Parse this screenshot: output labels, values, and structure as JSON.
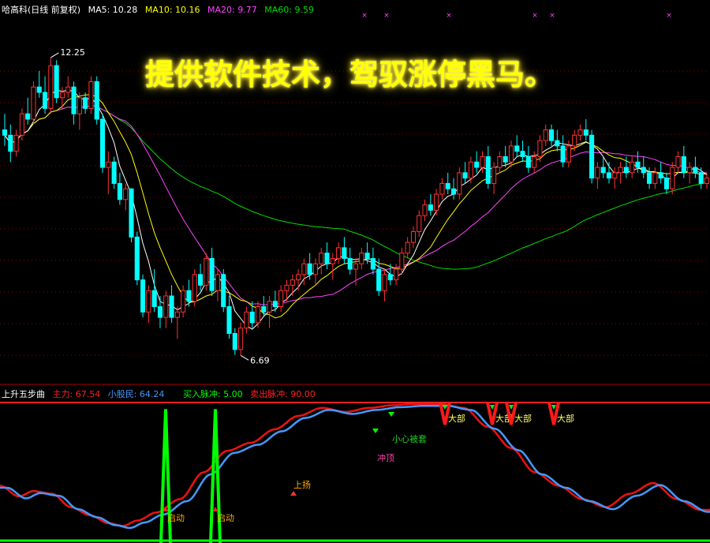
{
  "main_header": {
    "title": "哈高科(日线 前复权)",
    "ma5": "MA5: 10.28",
    "ma10": "MA10: 10.16",
    "ma20": "MA20: 9.77",
    "ma60": "MA60: 9.59"
  },
  "banner": "提供软件技术，驾驭涨停黑马。",
  "sub_header": {
    "title": "上升五步曲",
    "zhuli": "主力: 67.54",
    "xiaogumin": "小股民: 64.24",
    "buy_pulse": "买入脉冲: 5.00",
    "sell_pulse": "卖出脉冲: 90.00"
  },
  "colors": {
    "up": "#ff3333",
    "down": "#00ffff",
    "ma5": "#ffffff",
    "ma10": "#ffff00",
    "ma20": "#ff44ff",
    "ma60": "#00dd00",
    "zhuli": "#ee1111",
    "xiaogumin": "#4499ff",
    "pulse": "#00ff00",
    "grid": "#8b0000"
  },
  "chart_data": [
    {
      "type": "candlestick",
      "title": "哈高科(日线 前复权)",
      "ylim": [
        6.4,
        13.0
      ],
      "annotations": {
        "high": "12.25",
        "low": "6.69"
      },
      "candles": [
        [
          10.9,
          11.2,
          10.6,
          10.8
        ],
        [
          10.8,
          11.0,
          10.3,
          10.5
        ],
        [
          10.5,
          10.9,
          10.4,
          10.8
        ],
        [
          10.8,
          11.3,
          10.7,
          11.2
        ],
        [
          11.2,
          11.5,
          11.0,
          11.1
        ],
        [
          11.1,
          11.8,
          11.0,
          11.7
        ],
        [
          11.7,
          12.0,
          11.5,
          11.6
        ],
        [
          11.6,
          11.9,
          11.2,
          11.3
        ],
        [
          11.3,
          12.25,
          11.2,
          12.1
        ],
        [
          12.1,
          12.2,
          11.4,
          11.5
        ],
        [
          11.5,
          11.7,
          11.3,
          11.6
        ],
        [
          11.6,
          11.9,
          11.5,
          11.7
        ],
        [
          11.7,
          11.8,
          11.0,
          11.2
        ],
        [
          11.2,
          11.6,
          10.9,
          11.5
        ],
        [
          11.5,
          11.6,
          11.2,
          11.3
        ],
        [
          11.3,
          11.9,
          11.2,
          11.8
        ],
        [
          11.8,
          11.9,
          11.0,
          11.1
        ],
        [
          11.1,
          11.2,
          10.1,
          10.2
        ],
        [
          10.2,
          10.5,
          9.7,
          10.3
        ],
        [
          10.3,
          10.4,
          9.8,
          9.9
        ],
        [
          9.9,
          10.1,
          9.5,
          9.6
        ],
        [
          9.6,
          9.9,
          9.4,
          9.8
        ],
        [
          9.8,
          9.8,
          8.8,
          8.9
        ],
        [
          8.9,
          9.0,
          8.0,
          8.1
        ],
        [
          8.1,
          8.2,
          7.4,
          7.5
        ],
        [
          7.5,
          8.0,
          7.3,
          7.9
        ],
        [
          7.9,
          8.3,
          7.5,
          7.6
        ],
        [
          7.6,
          7.8,
          7.2,
          7.4
        ],
        [
          7.4,
          7.9,
          7.2,
          7.8
        ],
        [
          7.8,
          8.0,
          7.3,
          7.4
        ],
        [
          7.4,
          7.6,
          7.0,
          7.5
        ],
        [
          7.5,
          8.0,
          7.4,
          7.9
        ],
        [
          7.9,
          8.1,
          7.6,
          7.7
        ],
        [
          7.7,
          8.3,
          7.6,
          8.2
        ],
        [
          8.2,
          8.4,
          7.9,
          8.0
        ],
        [
          8.0,
          8.6,
          7.9,
          8.5
        ],
        [
          8.5,
          8.7,
          7.8,
          7.9
        ],
        [
          7.9,
          8.3,
          7.7,
          8.2
        ],
        [
          8.2,
          8.3,
          7.5,
          7.6
        ],
        [
          7.6,
          7.8,
          7.0,
          7.1
        ],
        [
          7.1,
          7.2,
          6.7,
          6.8
        ],
        [
          6.8,
          7.3,
          6.69,
          7.2
        ],
        [
          7.2,
          7.6,
          7.1,
          7.5
        ],
        [
          7.5,
          7.7,
          7.2,
          7.3
        ],
        [
          7.3,
          7.7,
          7.2,
          7.6
        ],
        [
          7.6,
          7.8,
          7.4,
          7.5
        ],
        [
          7.5,
          7.8,
          7.2,
          7.7
        ],
        [
          7.7,
          7.9,
          7.5,
          7.6
        ],
        [
          7.6,
          8.0,
          7.5,
          7.9
        ],
        [
          7.9,
          8.1,
          7.7,
          8.0
        ],
        [
          8.0,
          8.2,
          7.8,
          8.1
        ],
        [
          8.1,
          8.3,
          7.9,
          8.2
        ],
        [
          8.2,
          8.5,
          8.0,
          8.4
        ],
        [
          8.4,
          8.6,
          8.1,
          8.2
        ],
        [
          8.2,
          8.5,
          8.0,
          8.4
        ],
        [
          8.4,
          8.7,
          8.2,
          8.6
        ],
        [
          8.6,
          8.8,
          8.3,
          8.4
        ],
        [
          8.4,
          8.6,
          8.1,
          8.5
        ],
        [
          8.5,
          8.8,
          8.4,
          8.7
        ],
        [
          8.7,
          8.9,
          8.4,
          8.5
        ],
        [
          8.5,
          8.7,
          8.2,
          8.3
        ],
        [
          8.3,
          8.5,
          8.0,
          8.4
        ],
        [
          8.4,
          8.7,
          8.3,
          8.6
        ],
        [
          8.6,
          8.8,
          8.4,
          8.5
        ],
        [
          8.5,
          8.7,
          8.2,
          8.3
        ],
        [
          8.3,
          8.5,
          7.8,
          7.9
        ],
        [
          7.9,
          8.3,
          7.7,
          8.2
        ],
        [
          8.2,
          8.4,
          8.0,
          8.1
        ],
        [
          8.1,
          8.4,
          8.0,
          8.3
        ],
        [
          8.3,
          8.7,
          8.2,
          8.6
        ],
        [
          8.6,
          8.9,
          8.5,
          8.8
        ],
        [
          8.8,
          9.1,
          8.7,
          9.0
        ],
        [
          9.0,
          9.4,
          8.9,
          9.3
        ],
        [
          9.3,
          9.6,
          9.2,
          9.5
        ],
        [
          9.5,
          9.7,
          9.3,
          9.4
        ],
        [
          9.4,
          9.8,
          9.3,
          9.7
        ],
        [
          9.7,
          10.0,
          9.6,
          9.9
        ],
        [
          9.9,
          10.1,
          9.7,
          9.8
        ],
        [
          9.8,
          10.0,
          9.6,
          9.7
        ],
        [
          9.7,
          10.2,
          9.6,
          10.1
        ],
        [
          10.1,
          10.3,
          9.9,
          10.0
        ],
        [
          10.0,
          10.4,
          9.9,
          10.3
        ],
        [
          10.3,
          10.5,
          10.1,
          10.2
        ],
        [
          10.2,
          10.5,
          10.1,
          10.4
        ],
        [
          10.4,
          10.6,
          9.8,
          9.9
        ],
        [
          9.9,
          10.3,
          9.7,
          10.2
        ],
        [
          10.2,
          10.5,
          10.1,
          10.4
        ],
        [
          10.4,
          10.6,
          10.2,
          10.3
        ],
        [
          10.3,
          10.7,
          10.2,
          10.6
        ],
        [
          10.6,
          10.8,
          10.4,
          10.5
        ],
        [
          10.5,
          10.7,
          10.3,
          10.4
        ],
        [
          10.4,
          10.6,
          10.1,
          10.2
        ],
        [
          10.2,
          10.5,
          10.1,
          10.4
        ],
        [
          10.4,
          10.8,
          10.3,
          10.7
        ],
        [
          10.7,
          11.0,
          10.6,
          10.9
        ],
        [
          10.9,
          11.0,
          10.6,
          10.7
        ],
        [
          10.7,
          10.9,
          10.5,
          10.6
        ],
        [
          10.6,
          10.8,
          10.2,
          10.3
        ],
        [
          10.3,
          10.7,
          10.2,
          10.6
        ],
        [
          10.6,
          10.9,
          10.5,
          10.8
        ],
        [
          10.8,
          11.0,
          10.7,
          10.9
        ],
        [
          10.9,
          11.1,
          10.7,
          10.8
        ],
        [
          10.8,
          10.9,
          9.9,
          10.0
        ],
        [
          10.0,
          10.3,
          9.8,
          10.2
        ],
        [
          10.2,
          10.4,
          10.0,
          10.1
        ],
        [
          10.1,
          10.3,
          9.9,
          10.0
        ],
        [
          10.0,
          10.2,
          9.8,
          10.1
        ],
        [
          10.1,
          10.3,
          9.9,
          10.2
        ],
        [
          10.2,
          10.4,
          10.0,
          10.1
        ],
        [
          10.1,
          10.4,
          10.0,
          10.3
        ],
        [
          10.3,
          10.5,
          10.1,
          10.2
        ],
        [
          10.2,
          10.4,
          10.0,
          10.1
        ],
        [
          10.1,
          10.2,
          9.8,
          9.9
        ],
        [
          9.9,
          10.2,
          9.8,
          10.1
        ],
        [
          10.1,
          10.3,
          9.9,
          10.0
        ],
        [
          10.0,
          10.1,
          9.7,
          9.8
        ],
        [
          9.8,
          10.3,
          9.7,
          10.2
        ],
        [
          10.2,
          10.5,
          10.1,
          10.4
        ],
        [
          10.4,
          10.6,
          10.0,
          10.1
        ],
        [
          10.1,
          10.3,
          9.9,
          10.2
        ],
        [
          10.2,
          10.4,
          10.0,
          10.1
        ],
        [
          10.1,
          10.2,
          9.8,
          9.9
        ],
        [
          9.9,
          10.1,
          9.8,
          10.0
        ]
      ],
      "ma_series": [
        {
          "name": "MA5",
          "value": "10.28"
        },
        {
          "name": "MA10",
          "value": "10.16"
        },
        {
          "name": "MA20",
          "value": "9.77"
        },
        {
          "name": "MA60",
          "value": "9.59"
        }
      ]
    },
    {
      "type": "line",
      "title": "上升五步曲",
      "ylim": [
        0,
        100
      ],
      "series": [
        {
          "name": "主力",
          "last": 67.54
        },
        {
          "name": "小股民",
          "last": 64.24
        }
      ],
      "knots_zhuli": [
        [
          0,
          38
        ],
        [
          8,
          30
        ],
        [
          14,
          34
        ],
        [
          22,
          32
        ],
        [
          30,
          22
        ],
        [
          38,
          16
        ],
        [
          46,
          10
        ],
        [
          52,
          8
        ],
        [
          58,
          12
        ],
        [
          66,
          18
        ],
        [
          76,
          28
        ],
        [
          86,
          48
        ],
        [
          96,
          64
        ],
        [
          106,
          70
        ],
        [
          116,
          80
        ],
        [
          126,
          90
        ],
        [
          136,
          96
        ],
        [
          146,
          93
        ],
        [
          156,
          96
        ],
        [
          166,
          98
        ],
        [
          176,
          99
        ],
        [
          186,
          99
        ],
        [
          196,
          96
        ],
        [
          206,
          82
        ],
        [
          216,
          66
        ],
        [
          226,
          48
        ],
        [
          236,
          38
        ],
        [
          246,
          28
        ],
        [
          256,
          22
        ],
        [
          266,
          32
        ],
        [
          276,
          40
        ],
        [
          286,
          28
        ],
        [
          296,
          20
        ]
      ],
      "pulses": [
        {
          "type": "buy",
          "label": "启动",
          "x": 70,
          "height": 95
        },
        {
          "type": "buy",
          "label": "启动",
          "x": 91,
          "height": 95
        }
      ],
      "signals": [
        {
          "label": "上扬",
          "x": 120,
          "kind": "up-arrow"
        },
        {
          "label": "冲顶",
          "x": 160,
          "kind": "down-arrow"
        },
        {
          "label": "小心被套",
          "x": 165,
          "kind": "down-arrow"
        },
        {
          "label": "大部",
          "x": 188,
          "kind": "sell"
        },
        {
          "label": "大部",
          "x": 208,
          "kind": "sell"
        },
        {
          "label": "大部",
          "x": 216,
          "kind": "sell"
        },
        {
          "label": "大部",
          "x": 234,
          "kind": "sell"
        }
      ]
    }
  ]
}
